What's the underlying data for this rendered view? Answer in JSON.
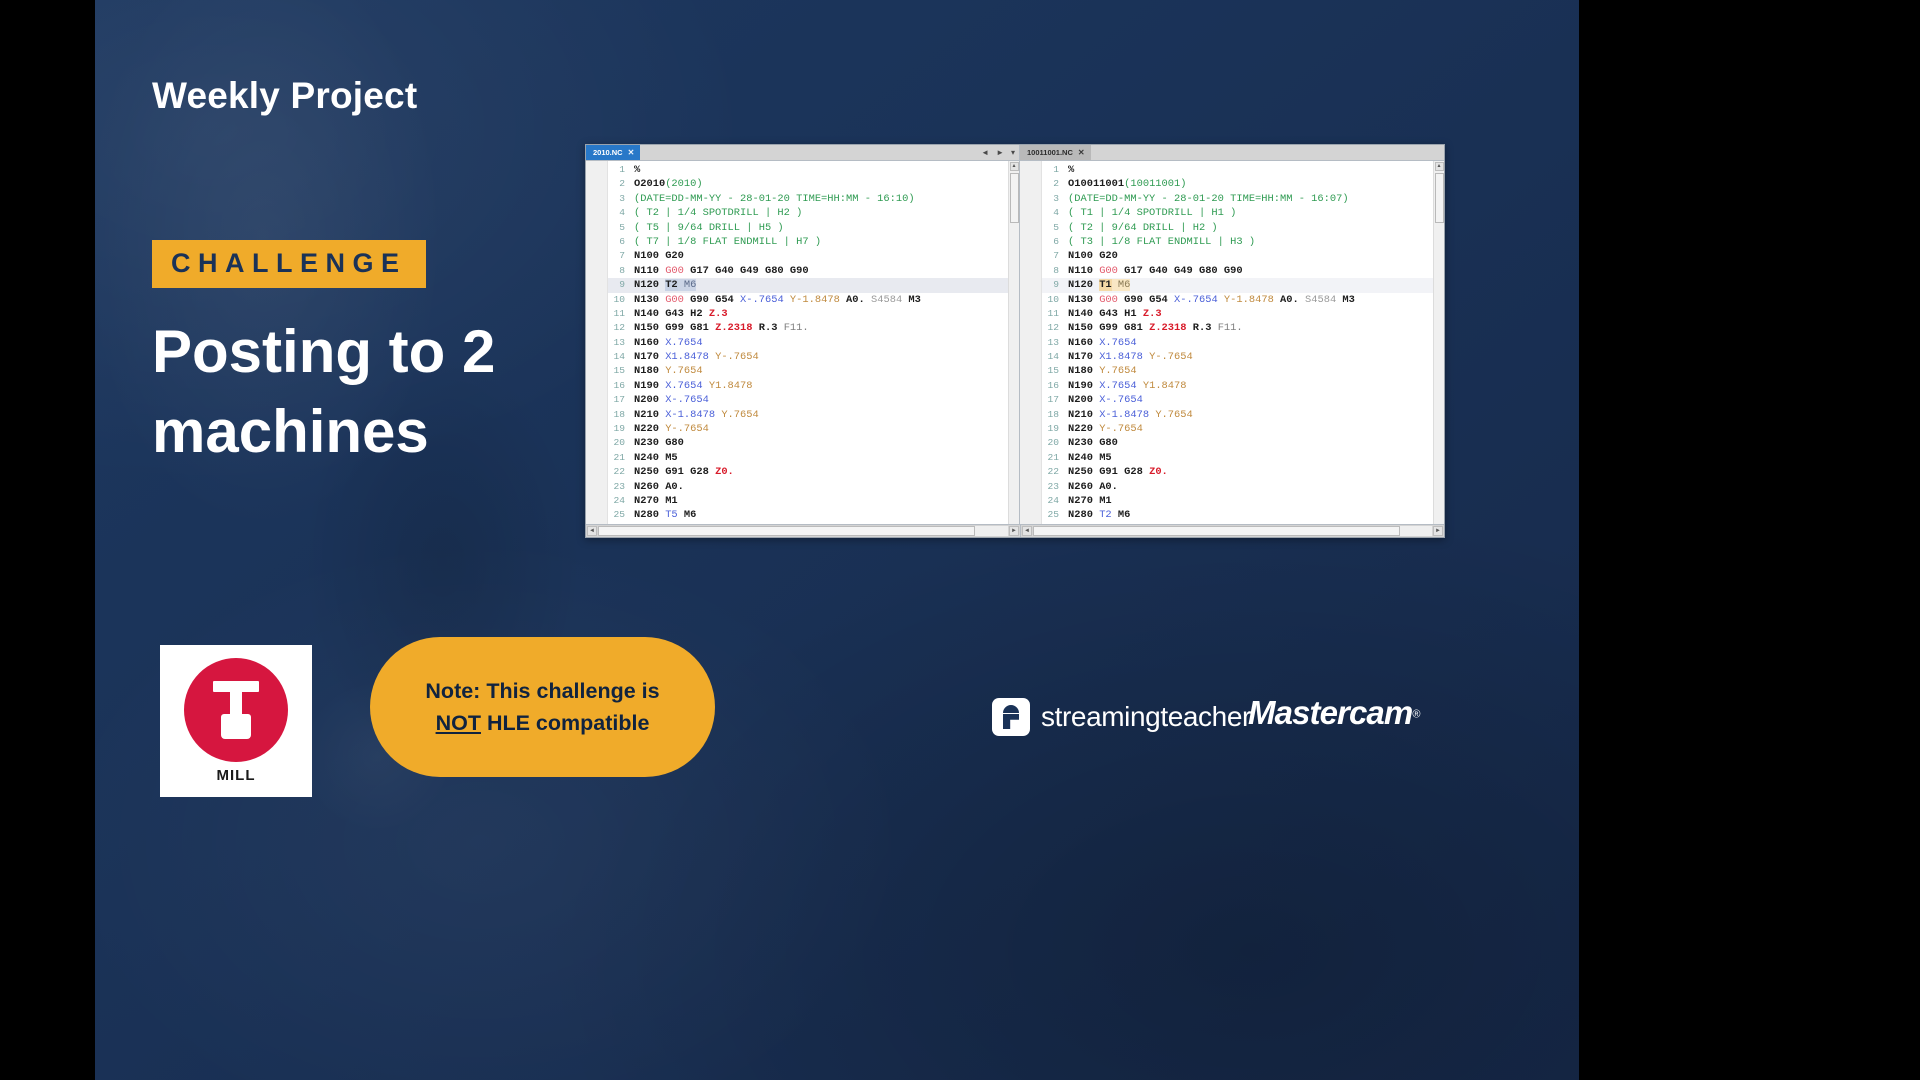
{
  "slide": {
    "eyebrow": "Weekly Project",
    "badge_label": "CHALLENGE",
    "headline": "Posting to 2 machines",
    "background_color": "#1a3257",
    "accent_color": "#f0ab2a"
  },
  "note": {
    "line1": "Note: This challenge is",
    "not_word": "NOT",
    "line2_rest": " HLE compatible",
    "background_color": "#f0ab2a"
  },
  "mill_logo": {
    "label": "MILL",
    "circle_color": "#d6163f"
  },
  "brands": {
    "streamingteacher": "streamingteacher",
    "mastercam": "Mastercam",
    "mastercam_tm": "®"
  },
  "editor": {
    "left_pane": {
      "tab_label": "2010.NC",
      "tab_close": "✕",
      "nav_prev": "◄",
      "nav_next": "►",
      "nav_menu": "▾",
      "scroll_up": "▴",
      "scroll_left": "◄",
      "scroll_right": "►",
      "lines": [
        {
          "n": "1",
          "tokens": [
            {
              "t": "%",
              "c": "tk-plain"
            }
          ]
        },
        {
          "n": "2",
          "tokens": [
            {
              "t": "O2010",
              "c": "tk-plain"
            },
            {
              "t": "(2010)",
              "c": "tk-comment"
            }
          ]
        },
        {
          "n": "3",
          "tokens": [
            {
              "t": "(DATE=DD-MM-YY - 28-01-20 TIME=HH:MM - 16:10)",
              "c": "tk-comment"
            }
          ]
        },
        {
          "n": "4",
          "tokens": [
            {
              "t": "( T2 | 1/4 SPOTDRILL | H2 )",
              "c": "tk-comment"
            }
          ]
        },
        {
          "n": "5",
          "tokens": [
            {
              "t": "( T5 | 9/64 DRILL | H5 )",
              "c": "tk-comment"
            }
          ]
        },
        {
          "n": "6",
          "tokens": [
            {
              "t": "( T7 | 1/8 FLAT ENDMILL | H7 )",
              "c": "tk-comment"
            }
          ]
        },
        {
          "n": "7",
          "tokens": [
            {
              "t": "N100 ",
              "c": "tk-nword"
            },
            {
              "t": "G20",
              "c": "tk-plain"
            }
          ]
        },
        {
          "n": "8",
          "tokens": [
            {
              "t": "N110 ",
              "c": "tk-nword"
            },
            {
              "t": "G00",
              "c": "tk-gred"
            },
            {
              "t": " G17 G40 G49 G80 G90",
              "c": "tk-plain"
            }
          ]
        },
        {
          "n": "9",
          "hl": true,
          "tokens": [
            {
              "t": "N120 ",
              "c": "tk-nword"
            },
            {
              "t": "T2",
              "c": "tk-sel-l"
            },
            {
              "t": " M6",
              "c": "tk-sel-lm"
            }
          ]
        },
        {
          "n": "10",
          "tokens": [
            {
              "t": "N130 ",
              "c": "tk-nword"
            },
            {
              "t": "G00",
              "c": "tk-gred"
            },
            {
              "t": " G90 G54 ",
              "c": "tk-plain"
            },
            {
              "t": "X-.7654 ",
              "c": "tk-blue"
            },
            {
              "t": "Y-1.8478 ",
              "c": "tk-orange"
            },
            {
              "t": "A0. ",
              "c": "tk-plain"
            },
            {
              "t": "S4584",
              "c": "tk-gray2"
            },
            {
              "t": " M3",
              "c": "tk-plain"
            }
          ]
        },
        {
          "n": "11",
          "tokens": [
            {
              "t": "N140 ",
              "c": "tk-nword"
            },
            {
              "t": "G43 H2 ",
              "c": "tk-plain"
            },
            {
              "t": "Z.3",
              "c": "tk-red"
            }
          ]
        },
        {
          "n": "12",
          "tokens": [
            {
              "t": "N150 ",
              "c": "tk-nword"
            },
            {
              "t": "G99 G81 ",
              "c": "tk-plain"
            },
            {
              "t": "Z.2318",
              "c": "tk-red"
            },
            {
              "t": " R.3 ",
              "c": "tk-plain"
            },
            {
              "t": "F11.",
              "c": "tk-grey"
            }
          ]
        },
        {
          "n": "13",
          "tokens": [
            {
              "t": "N160 ",
              "c": "tk-nword"
            },
            {
              "t": "X.7654",
              "c": "tk-blue"
            }
          ]
        },
        {
          "n": "14",
          "tokens": [
            {
              "t": "N170 ",
              "c": "tk-nword"
            },
            {
              "t": "X1.8478 ",
              "c": "tk-blue"
            },
            {
              "t": "Y-.7654",
              "c": "tk-orange"
            }
          ]
        },
        {
          "n": "15",
          "tokens": [
            {
              "t": "N180 ",
              "c": "tk-nword"
            },
            {
              "t": "Y.7654",
              "c": "tk-orange"
            }
          ]
        },
        {
          "n": "16",
          "tokens": [
            {
              "t": "N190 ",
              "c": "tk-nword"
            },
            {
              "t": "X.7654 ",
              "c": "tk-blue"
            },
            {
              "t": "Y1.8478",
              "c": "tk-orange"
            }
          ]
        },
        {
          "n": "17",
          "tokens": [
            {
              "t": "N200 ",
              "c": "tk-nword"
            },
            {
              "t": "X-.7654",
              "c": "tk-blue"
            }
          ]
        },
        {
          "n": "18",
          "tokens": [
            {
              "t": "N210 ",
              "c": "tk-nword"
            },
            {
              "t": "X-1.8478 ",
              "c": "tk-blue"
            },
            {
              "t": "Y.7654",
              "c": "tk-orange"
            }
          ]
        },
        {
          "n": "19",
          "tokens": [
            {
              "t": "N220 ",
              "c": "tk-nword"
            },
            {
              "t": "Y-.7654",
              "c": "tk-orange"
            }
          ]
        },
        {
          "n": "20",
          "tokens": [
            {
              "t": "N230 ",
              "c": "tk-nword"
            },
            {
              "t": "G80",
              "c": "tk-plain"
            }
          ]
        },
        {
          "n": "21",
          "tokens": [
            {
              "t": "N240 ",
              "c": "tk-nword"
            },
            {
              "t": "M5",
              "c": "tk-plain"
            }
          ]
        },
        {
          "n": "22",
          "tokens": [
            {
              "t": "N250 ",
              "c": "tk-nword"
            },
            {
              "t": "G91 G28 ",
              "c": "tk-plain"
            },
            {
              "t": "Z0.",
              "c": "tk-red"
            }
          ]
        },
        {
          "n": "23",
          "tokens": [
            {
              "t": "N260 ",
              "c": "tk-nword"
            },
            {
              "t": "A0.",
              "c": "tk-plain"
            }
          ]
        },
        {
          "n": "24",
          "tokens": [
            {
              "t": "N270 ",
              "c": "tk-nword"
            },
            {
              "t": "M1",
              "c": "tk-plain"
            }
          ]
        },
        {
          "n": "25",
          "tokens": [
            {
              "t": "N280 ",
              "c": "tk-nword"
            },
            {
              "t": "T5",
              "c": "tk-blue"
            },
            {
              "t": " M6",
              "c": "tk-plain"
            }
          ]
        }
      ]
    },
    "right_pane": {
      "tab_label": "10011001.NC",
      "tab_close": "✕",
      "scroll_up": "▴",
      "scroll_left": "◄",
      "scroll_right": "►",
      "lines": [
        {
          "n": "1",
          "tokens": [
            {
              "t": "%",
              "c": "tk-plain"
            }
          ]
        },
        {
          "n": "2",
          "tokens": [
            {
              "t": "O10011001",
              "c": "tk-plain"
            },
            {
              "t": "(10011001)",
              "c": "tk-comment"
            }
          ]
        },
        {
          "n": "3",
          "tokens": [
            {
              "t": "(DATE=DD-MM-YY - 28-01-20 TIME=HH:MM - 16:07)",
              "c": "tk-comment"
            }
          ]
        },
        {
          "n": "4",
          "tokens": [
            {
              "t": "( T1 | 1/4 SPOTDRILL | H1 )",
              "c": "tk-comment"
            }
          ]
        },
        {
          "n": "5",
          "tokens": [
            {
              "t": "( T2 | 9/64 DRILL | H2 )",
              "c": "tk-comment"
            }
          ]
        },
        {
          "n": "6",
          "tokens": [
            {
              "t": "( T3 | 1/8 FLAT ENDMILL | H3 )",
              "c": "tk-comment"
            }
          ]
        },
        {
          "n": "7",
          "tokens": [
            {
              "t": "N100 ",
              "c": "tk-nword"
            },
            {
              "t": "G20",
              "c": "tk-plain"
            }
          ]
        },
        {
          "n": "8",
          "tokens": [
            {
              "t": "N110 ",
              "c": "tk-nword"
            },
            {
              "t": "G00",
              "c": "tk-gred"
            },
            {
              "t": " G17 G40 G49 G80 G90",
              "c": "tk-plain"
            }
          ]
        },
        {
          "n": "9",
          "hl": true,
          "tokens": [
            {
              "t": "N120 ",
              "c": "tk-nword"
            },
            {
              "t": "T1",
              "c": "tk-sel-r"
            },
            {
              "t": " M6",
              "c": "tk-sel-rm"
            }
          ]
        },
        {
          "n": "10",
          "tokens": [
            {
              "t": "N130 ",
              "c": "tk-nword"
            },
            {
              "t": "G00",
              "c": "tk-gred"
            },
            {
              "t": " G90 G54 ",
              "c": "tk-plain"
            },
            {
              "t": "X-.7654 ",
              "c": "tk-blue"
            },
            {
              "t": "Y-1.8478 ",
              "c": "tk-orange"
            },
            {
              "t": "A0. ",
              "c": "tk-plain"
            },
            {
              "t": "S4584",
              "c": "tk-gray2"
            },
            {
              "t": " M3",
              "c": "tk-plain"
            }
          ]
        },
        {
          "n": "11",
          "tokens": [
            {
              "t": "N140 ",
              "c": "tk-nword"
            },
            {
              "t": "G43 H1 ",
              "c": "tk-plain"
            },
            {
              "t": "Z.3",
              "c": "tk-red"
            }
          ]
        },
        {
          "n": "12",
          "tokens": [
            {
              "t": "N150 ",
              "c": "tk-nword"
            },
            {
              "t": "G99 G81 ",
              "c": "tk-plain"
            },
            {
              "t": "Z.2318",
              "c": "tk-red"
            },
            {
              "t": " R.3 ",
              "c": "tk-plain"
            },
            {
              "t": "F11.",
              "c": "tk-grey"
            }
          ]
        },
        {
          "n": "13",
          "tokens": [
            {
              "t": "N160 ",
              "c": "tk-nword"
            },
            {
              "t": "X.7654",
              "c": "tk-blue"
            }
          ]
        },
        {
          "n": "14",
          "tokens": [
            {
              "t": "N170 ",
              "c": "tk-nword"
            },
            {
              "t": "X1.8478 ",
              "c": "tk-blue"
            },
            {
              "t": "Y-.7654",
              "c": "tk-orange"
            }
          ]
        },
        {
          "n": "15",
          "tokens": [
            {
              "t": "N180 ",
              "c": "tk-nword"
            },
            {
              "t": "Y.7654",
              "c": "tk-orange"
            }
          ]
        },
        {
          "n": "16",
          "tokens": [
            {
              "t": "N190 ",
              "c": "tk-nword"
            },
            {
              "t": "X.7654 ",
              "c": "tk-blue"
            },
            {
              "t": "Y1.8478",
              "c": "tk-orange"
            }
          ]
        },
        {
          "n": "17",
          "tokens": [
            {
              "t": "N200 ",
              "c": "tk-nword"
            },
            {
              "t": "X-.7654",
              "c": "tk-blue"
            }
          ]
        },
        {
          "n": "18",
          "tokens": [
            {
              "t": "N210 ",
              "c": "tk-nword"
            },
            {
              "t": "X-1.8478 ",
              "c": "tk-blue"
            },
            {
              "t": "Y.7654",
              "c": "tk-orange"
            }
          ]
        },
        {
          "n": "19",
          "tokens": [
            {
              "t": "N220 ",
              "c": "tk-nword"
            },
            {
              "t": "Y-.7654",
              "c": "tk-orange"
            }
          ]
        },
        {
          "n": "20",
          "tokens": [
            {
              "t": "N230 ",
              "c": "tk-nword"
            },
            {
              "t": "G80",
              "c": "tk-plain"
            }
          ]
        },
        {
          "n": "21",
          "tokens": [
            {
              "t": "N240 ",
              "c": "tk-nword"
            },
            {
              "t": "M5",
              "c": "tk-plain"
            }
          ]
        },
        {
          "n": "22",
          "tokens": [
            {
              "t": "N250 ",
              "c": "tk-nword"
            },
            {
              "t": "G91 G28 ",
              "c": "tk-plain"
            },
            {
              "t": "Z0.",
              "c": "tk-red"
            }
          ]
        },
        {
          "n": "23",
          "tokens": [
            {
              "t": "N260 ",
              "c": "tk-nword"
            },
            {
              "t": "A0.",
              "c": "tk-plain"
            }
          ]
        },
        {
          "n": "24",
          "tokens": [
            {
              "t": "N270 ",
              "c": "tk-nword"
            },
            {
              "t": "M1",
              "c": "tk-plain"
            }
          ]
        },
        {
          "n": "25",
          "tokens": [
            {
              "t": "N280 ",
              "c": "tk-nword"
            },
            {
              "t": "T2",
              "c": "tk-blue"
            },
            {
              "t": " M6",
              "c": "tk-plain"
            }
          ]
        }
      ]
    }
  }
}
